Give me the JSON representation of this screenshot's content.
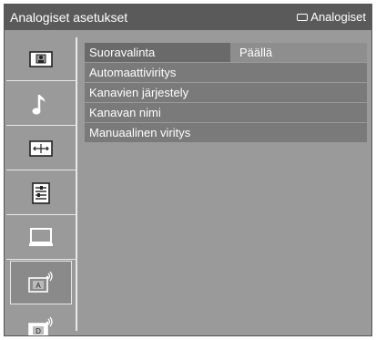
{
  "header": {
    "title": "Analogiset asetukset",
    "source_label": "Analogiset"
  },
  "sidebar": {
    "items": [
      {
        "name": "picture",
        "active": false
      },
      {
        "name": "sound",
        "active": false
      },
      {
        "name": "screen",
        "active": false
      },
      {
        "name": "setup",
        "active": false
      },
      {
        "name": "pc",
        "active": false
      },
      {
        "name": "analog-setup",
        "active": true
      },
      {
        "name": "digital-setup",
        "active": false
      }
    ]
  },
  "menu": {
    "items": [
      {
        "label": "Suoravalinta",
        "value": "Päällä"
      },
      {
        "label": "Automaattiviritys"
      },
      {
        "label": "Kanavien järjestely"
      },
      {
        "label": "Kanavan nimi"
      },
      {
        "label": "Manuaalinen viritys"
      }
    ]
  }
}
